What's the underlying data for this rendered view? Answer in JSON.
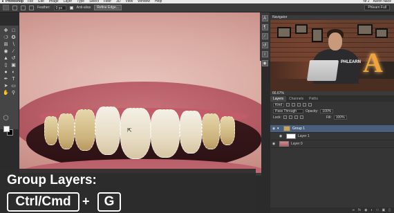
{
  "menubar": {
    "apple": "",
    "app": "Photoshop",
    "items": [
      "File",
      "Edit",
      "Image",
      "Layer",
      "Type",
      "Select",
      "Filter",
      "3D",
      "View",
      "Window",
      "Help"
    ],
    "right": {
      "status": "Nf 2",
      "user": "Aaron Nace"
    }
  },
  "options": {
    "feather_label": "Feather:",
    "feather_value": "0 px",
    "antialias_label": "Anti-alias",
    "refine_button": "Refine Edge...",
    "workspace": "Phlearn Full"
  },
  "navigator": {
    "tab": "Navigator",
    "shirt_text": "PHLEARN",
    "zoom": "66.67%"
  },
  "layers": {
    "tabs": [
      "Layers",
      "Channels",
      "Paths"
    ],
    "kind_label": "Kind",
    "blend_mode": "Pass Through",
    "opacity_label": "Opacity:",
    "opacity_value": "100%",
    "lock_label": "Lock:",
    "fill_label": "Fill:",
    "fill_value": "100%",
    "items": [
      {
        "name": "Group 1",
        "type": "group",
        "selected": true
      },
      {
        "name": "Layer 1",
        "type": "layer",
        "selected": false
      },
      {
        "name": "Layer 0",
        "type": "image",
        "selected": false
      }
    ],
    "bottom_icons": [
      "link-icon",
      "fx-icon",
      "mask-icon",
      "adjustment-icon",
      "folder-icon",
      "new-layer-icon",
      "trash-icon"
    ]
  },
  "caption": {
    "title": "Group Layers:",
    "key1": "Ctrl/Cmd",
    "plus": "+",
    "key2": "G"
  },
  "colors": {
    "accent": "#4a5f7d",
    "caption_bg": "#2d2d2d",
    "foreground": "#ffffff",
    "background": "#000000"
  }
}
